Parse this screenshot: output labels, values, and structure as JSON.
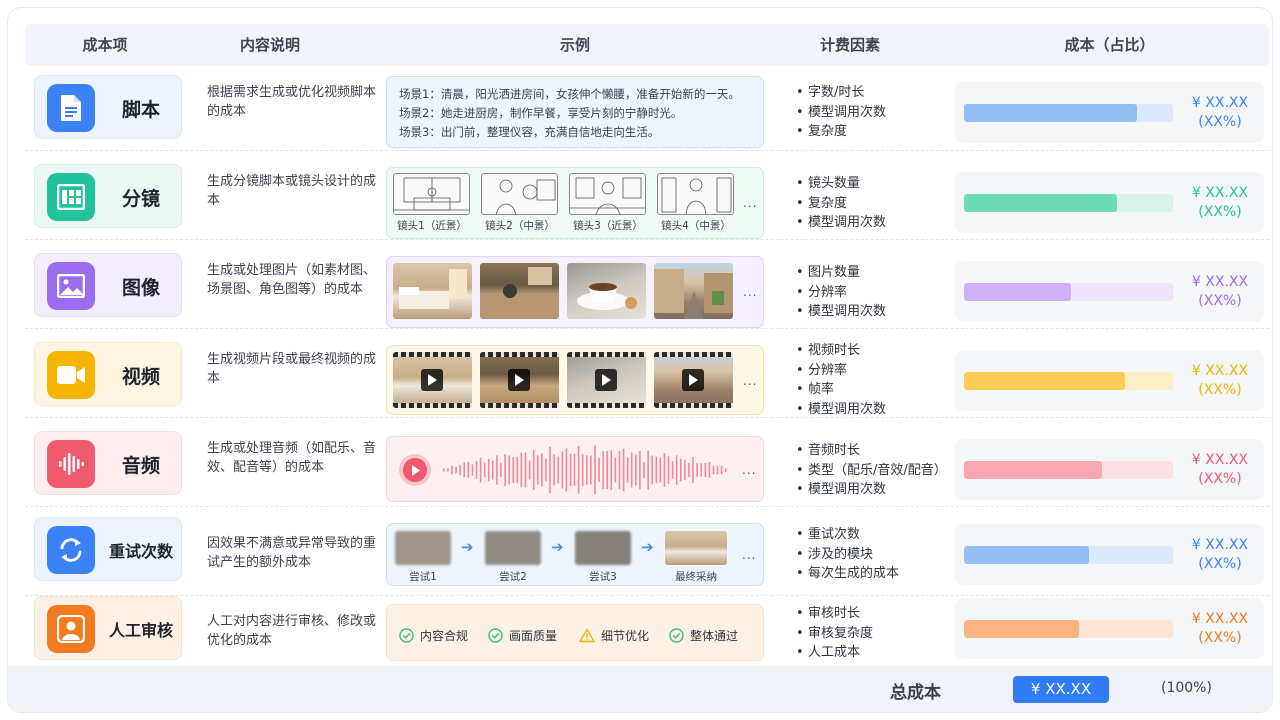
{
  "headers": {
    "cost_item": "成本项",
    "description": "内容说明",
    "example": "示例",
    "factors": "计费因素",
    "cost": "成本（占比）"
  },
  "rows": [
    {
      "name": "脚本",
      "icon": "document-icon",
      "color": "#3b82f6",
      "desc": "根据需求生成或优化视频脚本的成本",
      "example": {
        "scenes": [
          "场景1：清晨，阳光洒进房间，女孩伸个懒腰，准备开始新的一天。",
          "场景2：她走进厨房，制作早餐，享受片刻的宁静时光。",
          "场景3：出门前，整理仪容，充满自信地走向生活。"
        ]
      },
      "factors": [
        "字数/时长",
        "模型调用次数",
        "复杂度"
      ],
      "cost_value": "¥ XX.XX",
      "cost_pct": "(XX%)",
      "bar_fraction": 0.83
    },
    {
      "name": "分镜",
      "icon": "storyboard-grid-icon",
      "color": "#22c39a",
      "desc": "生成分镜脚本或镜头设计的成本",
      "example": {
        "shots": [
          "镜头1（近景）",
          "镜头2（中景）",
          "镜头3（近景）",
          "镜头4（中景）"
        ],
        "more": "..."
      },
      "factors": [
        "镜头数量",
        "复杂度",
        "模型调用次数"
      ],
      "cost_value": "¥ XX.XX",
      "cost_pct": "(XX%)",
      "bar_fraction": 0.73
    },
    {
      "name": "图像",
      "icon": "image-icon",
      "color": "#9b6cf0",
      "desc": "生成或处理图片（如素材图、场景图、角色图等）的成本",
      "example": {
        "more": "..."
      },
      "factors": [
        "图片数量",
        "分辨率",
        "模型调用次数"
      ],
      "cost_value": "¥ XX.XX",
      "cost_pct": "(XX%)",
      "bar_fraction": 0.51
    },
    {
      "name": "视频",
      "icon": "video-camera-icon",
      "color": "#f5b400",
      "desc": "生成视频片段或最终视频的成本",
      "example": {
        "more": "..."
      },
      "factors": [
        "视频时长",
        "分辨率",
        "帧率",
        "模型调用次数"
      ],
      "cost_value": "¥ XX.XX",
      "cost_pct": "(XX%)",
      "bar_fraction": 0.77
    },
    {
      "name": "音频",
      "icon": "sound-wave-icon",
      "color": "#f05a6e",
      "desc": "生成或处理音频（如配乐、音效、配音等）的成本",
      "example": {
        "more": "..."
      },
      "factors": [
        "音频时长",
        "类型（配乐/音效/配音）",
        "模型调用次数"
      ],
      "cost_value": "¥ XX.XX",
      "cost_pct": "(XX%)",
      "bar_fraction": 0.66
    },
    {
      "name": "重试次数",
      "icon": "refresh-icon",
      "color": "#3b82f6",
      "desc": "因效果不满意或异常导致的重试产生的额外成本",
      "example": {
        "attempts": [
          "尝试1",
          "尝试2",
          "尝试3",
          "最终采纳"
        ],
        "more": "..."
      },
      "factors": [
        "重试次数",
        "涉及的模块",
        "每次生成的成本"
      ],
      "cost_value": "¥ XX.XX",
      "cost_pct": "(XX%)",
      "bar_fraction": 0.6
    },
    {
      "name": "人工审核",
      "icon": "user-icon",
      "color": "#f47a20",
      "desc": "人工对内容进行审核、修改或优化的成本",
      "example": {
        "checks": [
          {
            "label": "内容合规",
            "status": "check-icon"
          },
          {
            "label": "画面质量",
            "status": "check-icon"
          },
          {
            "label": "细节优化",
            "status": "warning-icon"
          },
          {
            "label": "整体通过",
            "status": "check-icon"
          }
        ]
      },
      "factors": [
        "审核时长",
        "审核复杂度",
        "人工成本"
      ],
      "cost_value": "¥ XX.XX",
      "cost_pct": "(XX%)",
      "bar_fraction": 0.55
    }
  ],
  "total": {
    "label": "总成本",
    "value": "¥ XX.XX",
    "pct": "(100%)"
  }
}
